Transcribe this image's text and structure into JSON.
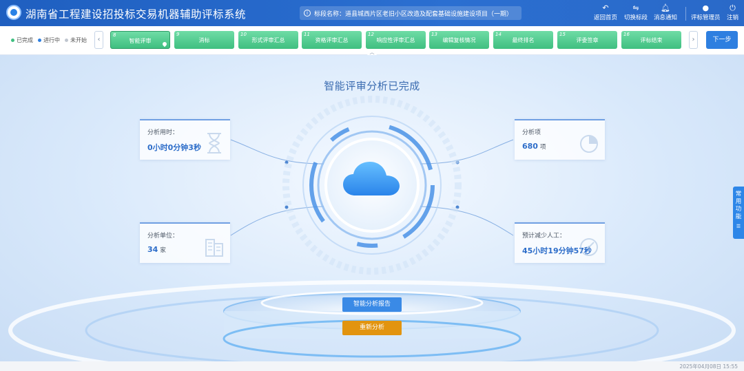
{
  "header": {
    "title": "湖南省工程建设招投标交易机器辅助评标系统",
    "project_label": "标段名称：",
    "project_name": "道县城西片区老旧小区改造及配套基础设施建设项目（一期）",
    "actions": [
      {
        "label": "返回首页",
        "icon": "undo-icon"
      },
      {
        "label": "切换标段",
        "icon": "swap-icon"
      },
      {
        "label": "消息通知",
        "icon": "bell-icon"
      },
      {
        "label": "评标管理员",
        "icon": "user-icon"
      },
      {
        "label": "注销",
        "icon": "power-icon"
      }
    ]
  },
  "legend": {
    "done": "已完成",
    "in_progress": "进行中",
    "not_started": "未开始"
  },
  "steps": [
    {
      "num": "8",
      "label": "智能评审"
    },
    {
      "num": "9",
      "label": "消标"
    },
    {
      "num": "10",
      "label": "形式评审汇总"
    },
    {
      "num": "11",
      "label": "资格评审汇总"
    },
    {
      "num": "12",
      "label": "响应性评审汇总"
    },
    {
      "num": "13",
      "label": "编辑复核情况"
    },
    {
      "num": "14",
      "label": "最终排名"
    },
    {
      "num": "15",
      "label": "评委签章"
    },
    {
      "num": "16",
      "label": "评标结束"
    }
  ],
  "next_label": "下一步",
  "main": {
    "title": "智能评审分析已完成",
    "cards": {
      "time": {
        "label": "分析用时：",
        "value": "0小时0分钟3秒"
      },
      "items": {
        "label": "分析项",
        "value": "680",
        "unit": "项"
      },
      "units": {
        "label": "分析单位：",
        "value": "34",
        "unit": "家"
      },
      "saved": {
        "label": "预计减少人工：",
        "value": "45小时19分钟57秒"
      }
    },
    "report_button": "智能分析报告",
    "reanalyze_button": "重新分析"
  },
  "side_tab": "常用功能",
  "footer_time": "2025年04月08日 15:55",
  "colors": {
    "header": "#2b6fd1",
    "step_done": "#3fbf80",
    "primary": "#2e7fe0",
    "warning": "#e2940f"
  }
}
